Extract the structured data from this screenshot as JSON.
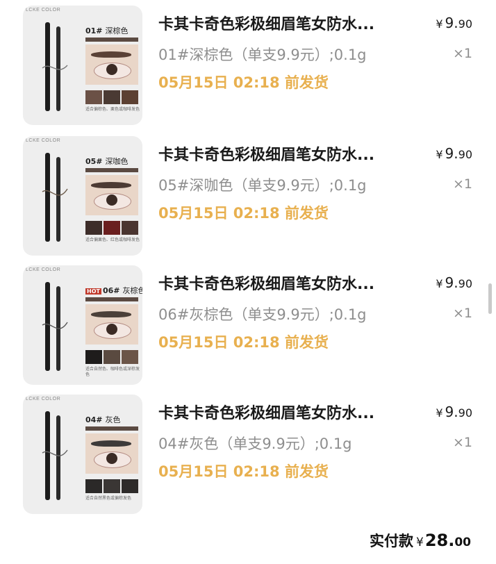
{
  "orders": [
    {
      "title": "卡其卡奇色彩极细眉笔女防水...",
      "price_symbol": "¥",
      "price_int": "9.",
      "price_dec": "90",
      "spec": "01#深棕色（单支9.9元）;0.1g",
      "qty": "×1",
      "ship": "05月15日 02:18 前发货",
      "thumb": {
        "brand": "LCKE COLOR",
        "hot": "",
        "code": "01#",
        "shade": "深棕色",
        "note": "适合偏棕色、栗色或咖啡发色",
        "brow_color": "#5a4136",
        "swatch_colors": [
          "#6b5146",
          "#4a3a33",
          "#5c4032"
        ]
      }
    },
    {
      "title": "卡其卡奇色彩极细眉笔女防水...",
      "price_symbol": "¥",
      "price_int": "9.",
      "price_dec": "90",
      "spec": "05#深咖色（单支9.9元）;0.1g",
      "qty": "×1",
      "ship": "05月15日 02:18 前发货",
      "thumb": {
        "brand": "LCKE COLOR",
        "hot": "",
        "code": "05#",
        "shade": "深咖色",
        "note": "适合偏栗色、红色或咖啡发色",
        "brow_color": "#4c3a33",
        "swatch_colors": [
          "#3d2d29",
          "#6a1f1f",
          "#4a3530"
        ]
      }
    },
    {
      "title": "卡其卡奇色彩极细眉笔女防水...",
      "price_symbol": "¥",
      "price_int": "9.",
      "price_dec": "90",
      "spec": "06#灰棕色（单支9.9元）;0.1g",
      "qty": "×1",
      "ship": "05月15日 02:18 前发货",
      "thumb": {
        "brand": "LCKE COLOR",
        "hot": "HOT",
        "code": "06#",
        "shade": "灰棕色",
        "note": "适合自然色、咖啡色或深棕发色",
        "brow_color": "#4b4039",
        "swatch_colors": [
          "#1e1c1b",
          "#5a4a40",
          "#6b5548"
        ]
      }
    },
    {
      "title": "卡其卡奇色彩极细眉笔女防水...",
      "price_symbol": "¥",
      "price_int": "9.",
      "price_dec": "90",
      "spec": "04#灰色（单支9.9元）;0.1g",
      "qty": "×1",
      "ship": "05月15日 02:18 前发货",
      "thumb": {
        "brand": "LCKE COLOR",
        "hot": "",
        "code": "04#",
        "shade": "灰色",
        "note": "适合自然黑色或偏棕发色",
        "brow_color": "#3d3a39",
        "swatch_colors": [
          "#2b2928",
          "#3a3634",
          "#2e2b2a"
        ]
      }
    }
  ],
  "summary": {
    "label": "实付款",
    "currency": "¥",
    "amount_int": "28.",
    "amount_dec": "00"
  },
  "colors": {
    "ship_text": "#e8b04f",
    "spec_text": "#8e8e8e",
    "thumb_bg": "#eeeeee"
  }
}
